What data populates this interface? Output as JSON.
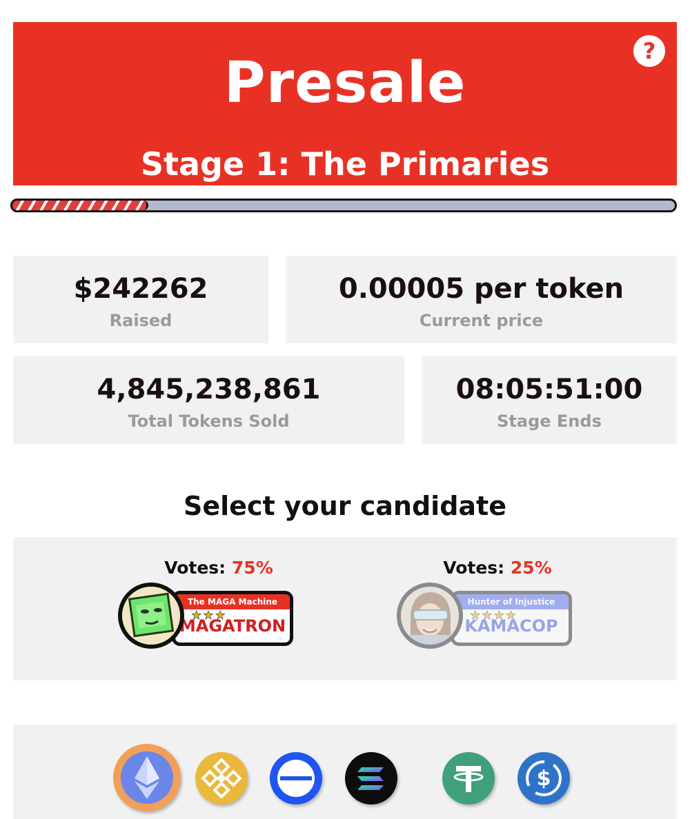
{
  "header": {
    "title": "Presale",
    "subtitle": "Stage 1: The Primaries",
    "help_label": "?"
  },
  "progress": {
    "fraction": 0.205
  },
  "stats": {
    "raised": {
      "value": "$242262",
      "label": "Raised"
    },
    "price": {
      "value": "0.00005 per token",
      "label": "Current price"
    },
    "sold": {
      "value": "4,845,238,861",
      "label": "Total Tokens Sold"
    },
    "ends": {
      "value": "08:05:51:00",
      "label": "Stage Ends"
    }
  },
  "candidates": {
    "title": "Select your candidate",
    "votes_label": "Votes:",
    "list": [
      {
        "votes": "75%",
        "tag": "The MAGA Machine",
        "name": "MAGATRON",
        "stars": "★★★",
        "selected": true
      },
      {
        "votes": "25%",
        "tag": "Hunter of Injustice",
        "name": "KAMACOP",
        "stars": "★★★★",
        "selected": false
      }
    ]
  },
  "payment": {
    "coins": [
      "ethereum-icon",
      "bnb-icon",
      "base-icon",
      "solana-icon",
      "tether-icon",
      "usdc-icon"
    ],
    "selected": "ethereum-icon"
  },
  "colors": {
    "accent": "#e83125",
    "panel": "#f1f1f1",
    "muted_text": "#9a9a9a",
    "kamacop_blue": "#3f5cf0"
  }
}
